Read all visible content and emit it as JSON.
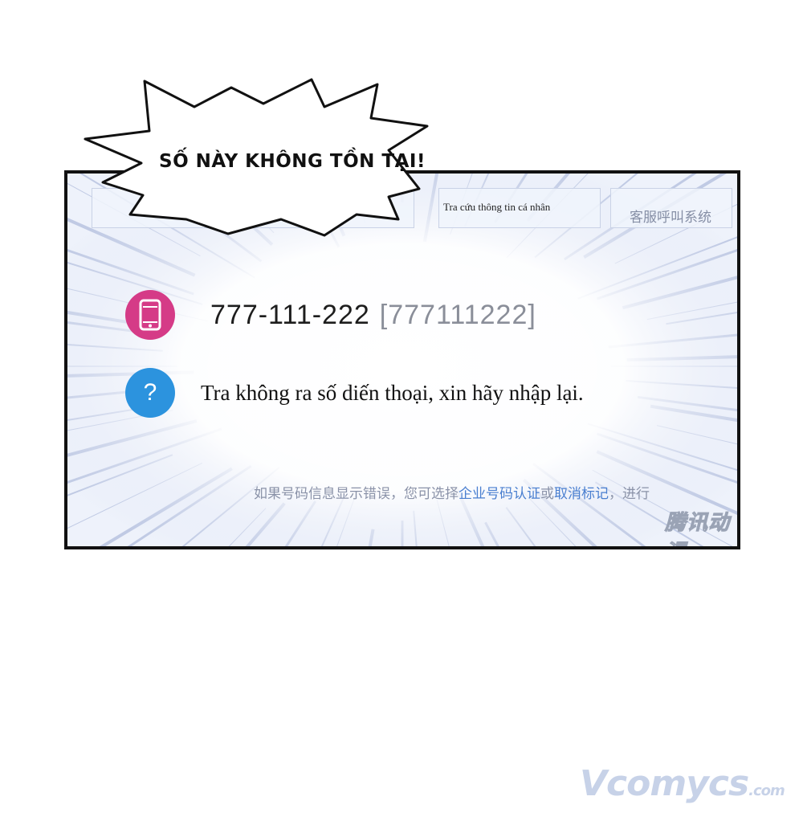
{
  "speech_bubble": {
    "text": "SỐ NÀY KHÔNG TỒN TẠI!"
  },
  "tabs": {
    "lookup_label": "Tra cứu thông tin cá nhân",
    "support_label": "客服呼叫系统"
  },
  "result": {
    "phone_number": "777-111-222",
    "phone_raw": "[777111222]",
    "message": "Tra không ra số diến thoại, xin hãy nhập lại."
  },
  "footer": {
    "prefix": "如果号码信息显示错误，您可选择",
    "link1": "企业号码认证",
    "middle": "或",
    "link2": "取消标记",
    "suffix": "，进行"
  },
  "watermarks": {
    "panel": "腾讯动漫",
    "site": "Vcomycs",
    "site_suffix": ".com"
  },
  "icons": {
    "phone": "phone-icon",
    "help": "question-icon"
  },
  "colors": {
    "phone_icon_bg": "#d53b87",
    "help_icon_bg": "#2c93de",
    "link": "#4a7fd0"
  }
}
